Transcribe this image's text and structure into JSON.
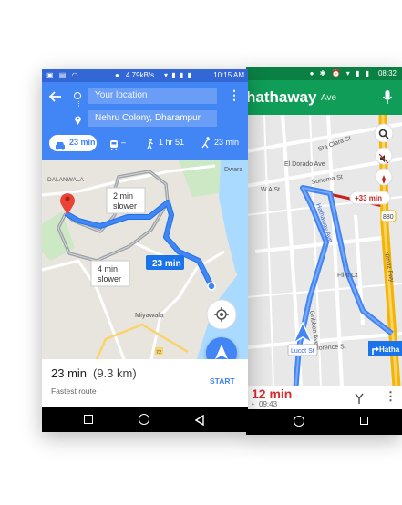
{
  "phone_right": {
    "status_time": "08:32",
    "street_partial": "hathaway",
    "street_suffix": "Ave",
    "map_labels": {
      "el_dorado": "El Dorado Ave",
      "sta_clara": "Sta Clara St",
      "sonoma": "Sonoma St",
      "wa_st": "W A St",
      "flint_ct": "Flint Ct",
      "gribben": "Gribben Ave",
      "florence": "Florence St",
      "hathaway_vert": "Hathaway Ave",
      "nimitz": "Nimitz Fwy",
      "lucot": "Lucot St",
      "interstate": "880"
    },
    "traffic_delay": "+33 min",
    "next_turn_label": "Hatha",
    "eta_time": "12 min",
    "arrival": "09:43",
    "colors": {
      "header": "#0f9d58",
      "route": "#4285f4",
      "eta": "#d32f2f",
      "traffic": "#c5221f"
    }
  },
  "phone_left": {
    "status_info": "4.79kB/s",
    "status_time": "10:15 AM",
    "origin_placeholder": "Your location",
    "destination": "Nehru Colony, Dharampur",
    "modes": {
      "drive": "23 min",
      "walk": "1 hr 51",
      "ride": "23 min"
    },
    "map_labels": {
      "dalanwala": "DALANWALA",
      "dwara": "Dwara",
      "miyawala": "Miyawala",
      "road_72": "72"
    },
    "alt_route_1": [
      "2 min",
      "slower"
    ],
    "alt_route_2": [
      "4 min",
      "slower"
    ],
    "main_route": "23 min",
    "bottom": {
      "duration": "23 min",
      "distance": "(9.3 km)",
      "subtitle": "Fastest route",
      "start": "START"
    },
    "colors": {
      "header": "#4285f4",
      "route": "#4285f4",
      "alt_route": "#9aa0a6"
    }
  }
}
